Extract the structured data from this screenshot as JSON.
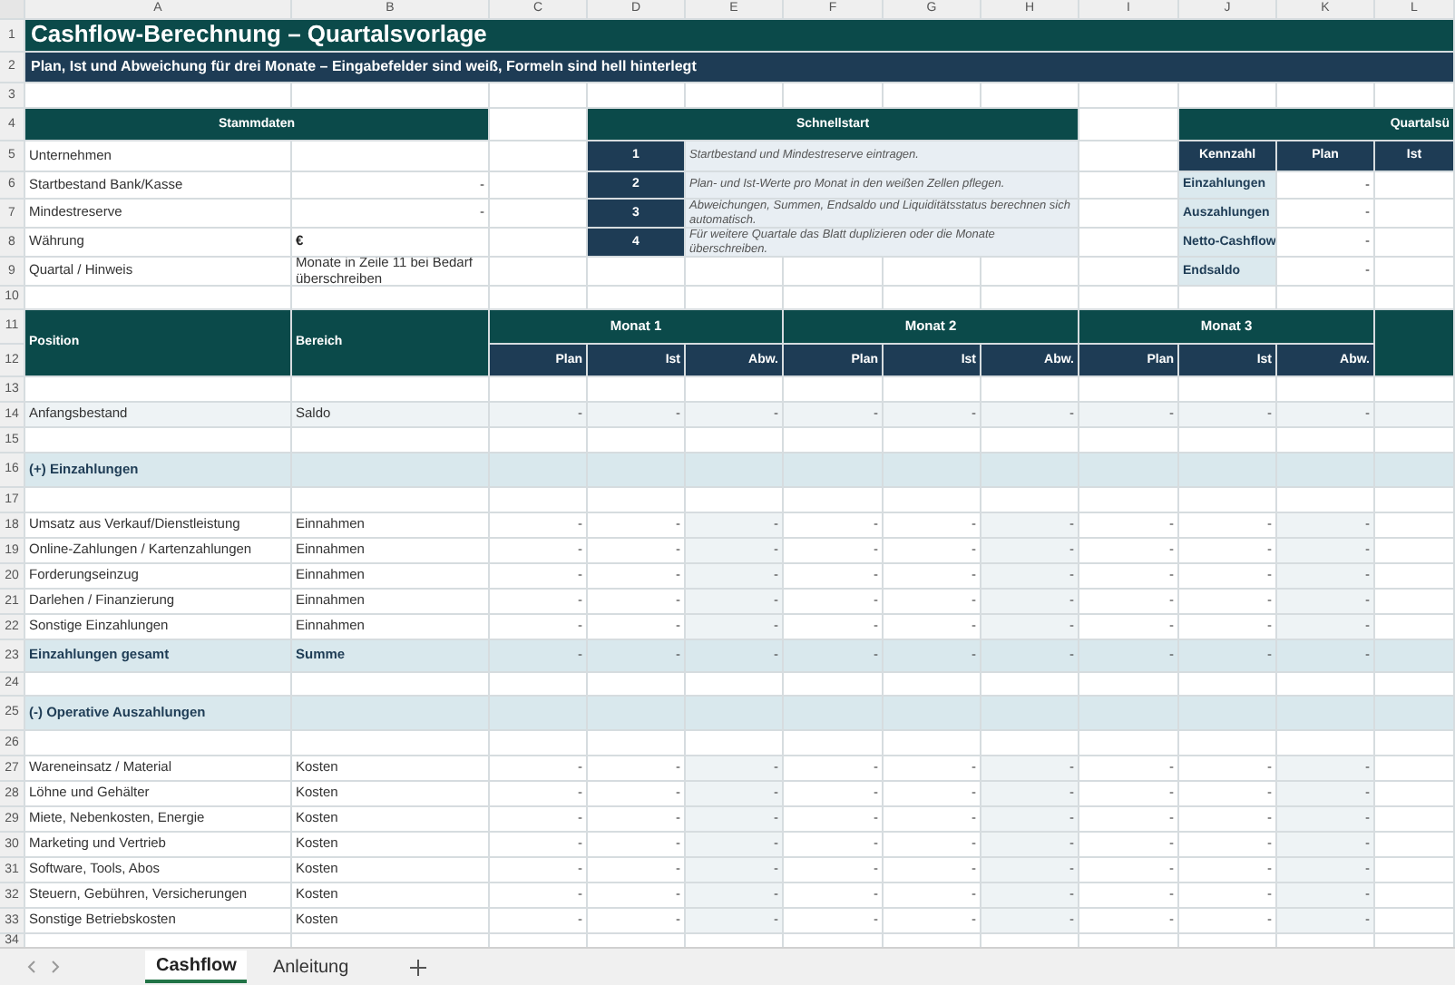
{
  "column_headers": [
    "A",
    "B",
    "C",
    "D",
    "E",
    "F",
    "G",
    "H",
    "I",
    "J",
    "K",
    "L"
  ],
  "row_numbers": [
    "1",
    "2",
    "3",
    "4",
    "5",
    "6",
    "7",
    "8",
    "9",
    "10",
    "11",
    "12",
    "13",
    "14",
    "15",
    "16",
    "17",
    "18",
    "19",
    "20",
    "21",
    "22",
    "23",
    "24",
    "25",
    "26",
    "27",
    "28",
    "29",
    "30",
    "31",
    "32",
    "33",
    "34"
  ],
  "title": "Cashflow-Berechnung – Quartalsvorlage",
  "subtitle": "Plan, Ist und Abweichung für drei Monate – Eingabefelder sind weiß, Formeln sind hell hinterlegt",
  "stammdaten": {
    "header": "Stammdaten",
    "rows": [
      {
        "label": "Unternehmen"
      },
      {
        "label": "Startbestand Bank/Kasse",
        "value": "-",
        "kind": "number"
      },
      {
        "label": "Mindestreserve",
        "value": "-",
        "kind": "number"
      },
      {
        "label": "Währung",
        "value": "€",
        "kind": "symbol"
      },
      {
        "label": "Quartal / Hinweis",
        "value": "Monate in Zeile 11 bei Bedarf überschreiben",
        "kind": "note"
      }
    ]
  },
  "schnellstart": {
    "header": "Schnellstart",
    "steps": [
      {
        "number": "1",
        "text": "Startbestand und Mindestreserve eintragen."
      },
      {
        "number": "2",
        "text": "Plan- und Ist-Werte pro Monat in den weißen Zellen pflegen."
      },
      {
        "number": "3",
        "text": "Abweichungen, Summen, Endsaldo und Liquiditätsstatus berechnen sich automatisch."
      },
      {
        "number": "4",
        "text": "Für weitere Quartale das Blatt duplizieren oder die Monate überschreiben."
      }
    ]
  },
  "quartal": {
    "header": "Quartalsü",
    "columns": [
      "Kennzahl",
      "Plan",
      "Ist"
    ],
    "rows": [
      {
        "label": "Einzahlungen",
        "plan": "-"
      },
      {
        "label": "Auszahlungen",
        "plan": "-"
      },
      {
        "label": "Netto-Cashflow",
        "plan": "-"
      },
      {
        "label": "Endsaldo",
        "plan": "-"
      }
    ]
  },
  "table": {
    "position": "Position",
    "bereich": "Bereich",
    "months": [
      {
        "name": "Monat 1",
        "columns": [
          "Plan",
          "Ist",
          "Abw."
        ]
      },
      {
        "name": "Monat 2",
        "columns": [
          "Plan",
          "Ist",
          "Abw."
        ]
      },
      {
        "name": "Monat 3",
        "columns": [
          "Plan",
          "Ist",
          "Abw."
        ]
      }
    ],
    "rows": [
      {
        "kind": "blank"
      },
      {
        "kind": "opening",
        "position": "Anfangsbestand",
        "bereich": "Saldo",
        "values": [
          "-",
          "-",
          "-",
          "-",
          "-",
          "-",
          "-",
          "-",
          "-"
        ]
      },
      {
        "kind": "blank"
      },
      {
        "kind": "section",
        "position": "(+) Einzahlungen"
      },
      {
        "kind": "blank"
      },
      {
        "kind": "data",
        "position": "Umsatz aus Verkauf/Dienstleistung",
        "bereich": "Einnahmen",
        "values": [
          "-",
          "-",
          "-",
          "-",
          "-",
          "-",
          "-",
          "-",
          "-"
        ]
      },
      {
        "kind": "data",
        "position": "Online-Zahlungen / Kartenzahlungen",
        "bereich": "Einnahmen",
        "values": [
          "-",
          "-",
          "-",
          "-",
          "-",
          "-",
          "-",
          "-",
          "-"
        ]
      },
      {
        "kind": "data",
        "position": "Forderungseinzug",
        "bereich": "Einnahmen",
        "values": [
          "-",
          "-",
          "-",
          "-",
          "-",
          "-",
          "-",
          "-",
          "-"
        ]
      },
      {
        "kind": "data",
        "position": "Darlehen / Finanzierung",
        "bereich": "Einnahmen",
        "values": [
          "-",
          "-",
          "-",
          "-",
          "-",
          "-",
          "-",
          "-",
          "-"
        ]
      },
      {
        "kind": "data",
        "position": "Sonstige Einzahlungen",
        "bereich": "Einnahmen",
        "values": [
          "-",
          "-",
          "-",
          "-",
          "-",
          "-",
          "-",
          "-",
          "-"
        ]
      },
      {
        "kind": "total",
        "position": "Einzahlungen gesamt",
        "bereich": "Summe",
        "values": [
          "-",
          "-",
          "-",
          "-",
          "-",
          "-",
          "-",
          "-",
          "-"
        ]
      },
      {
        "kind": "blank"
      },
      {
        "kind": "section",
        "position": "(-) Operative Auszahlungen"
      },
      {
        "kind": "blank"
      },
      {
        "kind": "data",
        "position": "Wareneinsatz / Material",
        "bereich": "Kosten",
        "values": [
          "-",
          "-",
          "-",
          "-",
          "-",
          "-",
          "-",
          "-",
          "-"
        ]
      },
      {
        "kind": "data",
        "position": "Löhne und Gehälter",
        "bereich": "Kosten",
        "values": [
          "-",
          "-",
          "-",
          "-",
          "-",
          "-",
          "-",
          "-",
          "-"
        ]
      },
      {
        "kind": "data",
        "position": "Miete, Nebenkosten, Energie",
        "bereich": "Kosten",
        "values": [
          "-",
          "-",
          "-",
          "-",
          "-",
          "-",
          "-",
          "-",
          "-"
        ]
      },
      {
        "kind": "data",
        "position": "Marketing und Vertrieb",
        "bereich": "Kosten",
        "values": [
          "-",
          "-",
          "-",
          "-",
          "-",
          "-",
          "-",
          "-",
          "-"
        ]
      },
      {
        "kind": "data",
        "position": "Software, Tools, Abos",
        "bereich": "Kosten",
        "values": [
          "-",
          "-",
          "-",
          "-",
          "-",
          "-",
          "-",
          "-",
          "-"
        ]
      },
      {
        "kind": "data",
        "position": "Steuern, Gebühren, Versicherungen",
        "bereich": "Kosten",
        "values": [
          "-",
          "-",
          "-",
          "-",
          "-",
          "-",
          "-",
          "-",
          "-"
        ]
      },
      {
        "kind": "data",
        "position": "Sonstige Betriebskosten",
        "bereich": "Kosten",
        "values": [
          "-",
          "-",
          "-",
          "-",
          "-",
          "-",
          "-",
          "-",
          "-"
        ]
      }
    ]
  },
  "sheet_tabs": [
    {
      "label": "Cashflow",
      "selected": true
    },
    {
      "label": "Anleitung",
      "selected": false
    }
  ]
}
